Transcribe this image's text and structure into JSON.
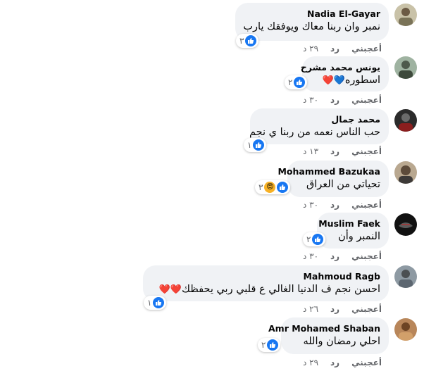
{
  "actions": {
    "like_label": "أعجبني",
    "reply_label": "رد"
  },
  "colors": {
    "bubble": "#f0f2f5",
    "like_blue": "#1877f2",
    "meta_gray": "#65676b",
    "heart_red": "#e02b2b"
  },
  "comments": [
    {
      "author": "Nadia El-Gayar",
      "text": "نمبر وان ربنا معاك ويوفقك يارب",
      "emoji": "",
      "reaction_count": "٣",
      "reaction_icons": [
        "like-icon"
      ],
      "timestamp": "٢٩ د"
    },
    {
      "author": "يونس محمد مشرح",
      "text": "اسطوره",
      "emoji": "💙❤️",
      "reaction_count": "٢",
      "reaction_icons": [
        "like-icon"
      ],
      "timestamp": "٣٠ د"
    },
    {
      "author": "محمد جمال",
      "text": "حب الناس نعمه من ربنا ي نجم",
      "emoji": "",
      "reaction_count": "١",
      "reaction_icons": [
        "like-icon"
      ],
      "timestamp": "١٣ د"
    },
    {
      "author": "Mohammed Bazukaa",
      "text": "تحياتي من العراق",
      "emoji": "",
      "reaction_count": "٣",
      "reaction_icons": [
        "like-icon",
        "care-icon"
      ],
      "timestamp": "٣٠ د"
    },
    {
      "author": "Muslim Faek",
      "text": "النمبر وأن",
      "emoji": "",
      "reaction_count": "٢",
      "reaction_icons": [
        "like-icon"
      ],
      "timestamp": "٣٠ د"
    },
    {
      "author": "Mahmoud Ragb",
      "text": "احسن نجم ف الدنيا الغالي ع قلبي ربي يحفظك",
      "emoji": "❤️❤️",
      "reaction_count": "١",
      "reaction_icons": [
        "like-icon"
      ],
      "timestamp": "٢٦ د"
    },
    {
      "author": "Amr Mohamed Shaban",
      "text": "احلي رمضان والله",
      "emoji": "",
      "reaction_count": "٢",
      "reaction_icons": [
        "like-icon"
      ],
      "timestamp": "٢٩ د"
    }
  ]
}
